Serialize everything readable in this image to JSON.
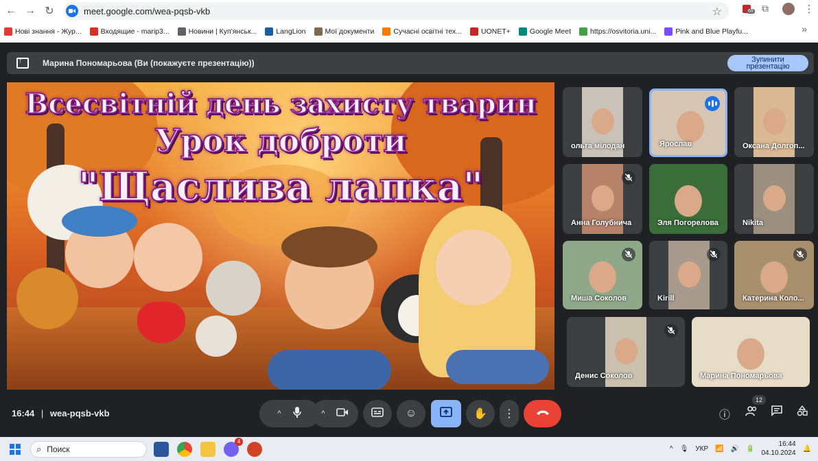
{
  "browser": {
    "url": "meet.google.com/wea-pqsb-vkb",
    "extension_badge": "69",
    "bookmarks": [
      {
        "label": "Нові знання - Жур...",
        "color": "#e53935"
      },
      {
        "label": "Входящие - marip3...",
        "color": "#d93025"
      },
      {
        "label": "Новини | Куп'янськ...",
        "color": "#5f6368"
      },
      {
        "label": "LangLion",
        "color": "#1b5e9b"
      },
      {
        "label": "Мої документи",
        "color": "#7e6b4f"
      },
      {
        "label": "Сучасні освітні тех...",
        "color": "#f57c00"
      },
      {
        "label": "UONET+",
        "color": "#c62828"
      },
      {
        "label": "Google Meet",
        "color": "#00897b"
      },
      {
        "label": "https://osvitoria.uni...",
        "color": "#43a047"
      },
      {
        "label": "Pink and Blue Playfu...",
        "color": "#7c4dff"
      }
    ]
  },
  "presentation_bar": {
    "label": "Марина Пономарьова (Ви (покажуєте презентацію))",
    "stop_button_line1": "Зупинити",
    "stop_button_line2": "презентацію"
  },
  "slide": {
    "title_line1": "Всесвітній день захисту тварин",
    "title_line2": "Урок доброти",
    "title_line3": "\"Щаслива лапка\""
  },
  "participants": [
    {
      "name": "ольга мілодан",
      "muted": false,
      "speaking": false
    },
    {
      "name": "Ярослав",
      "muted": false,
      "speaking": true
    },
    {
      "name": "Оксана Долгоп...",
      "muted": false,
      "speaking": false
    },
    {
      "name": "Анна Голубнича",
      "muted": true,
      "speaking": false
    },
    {
      "name": "Эля Погорелова",
      "muted": false,
      "speaking": false
    },
    {
      "name": "Nikita",
      "muted": false,
      "speaking": false
    },
    {
      "name": "Миша Соколов",
      "muted": true,
      "speaking": false
    },
    {
      "name": "Kirill",
      "muted": true,
      "speaking": false
    },
    {
      "name": "Катерина Коло...",
      "muted": true,
      "speaking": false
    },
    {
      "name": "Денис Соколов",
      "muted": true,
      "speaking": false
    },
    {
      "name": "Марина Пономарьова",
      "muted": false,
      "speaking": false
    }
  ],
  "controls": {
    "time": "16:44",
    "separator": "|",
    "meeting_code": "wea-pqsb-vkb",
    "people_count": "12"
  },
  "taskbar": {
    "search_placeholder": "Поиск",
    "viber_badge": "4",
    "language": "УКР",
    "clock_time": "16:44",
    "clock_date": "04.10.2024"
  }
}
